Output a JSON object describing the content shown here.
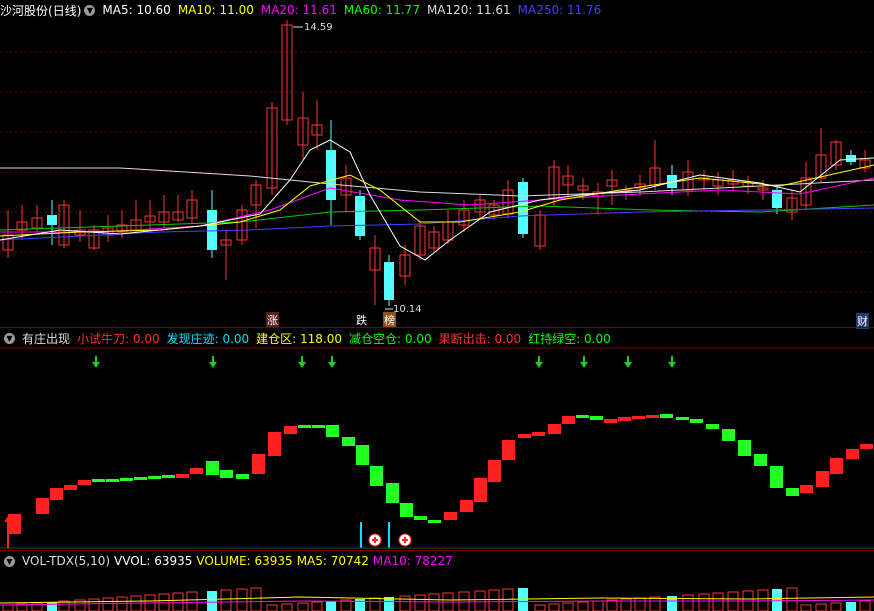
{
  "main": {
    "stock_name": "沙河股份",
    "period": "(日线)",
    "ma": [
      {
        "label": "MA5: 10.60",
        "color": "#ffffff"
      },
      {
        "label": "MA10: 11.00",
        "color": "#ffff00"
      },
      {
        "label": "MA20: 11.61",
        "color": "#ff00ff"
      },
      {
        "label": "MA60: 11.77",
        "color": "#00ff00"
      },
      {
        "label": "MA120: 11.61",
        "color": "#dddddd"
      },
      {
        "label": "MA250: 11.76",
        "color": "#4040ff"
      }
    ],
    "high_label": "14.59",
    "low_label": "10.14",
    "markers": [
      "涨",
      "跌",
      "榜",
      "财"
    ]
  },
  "indicator": {
    "name": "有庄出现",
    "items": [
      {
        "label": "小试牛刀: 0.00",
        "color": "#ff3030"
      },
      {
        "label": "发现庄迹: 0.00",
        "color": "#00e0ff"
      },
      {
        "label": "建仓区: 118.00",
        "color": "#ffff00"
      },
      {
        "label": "减仓空仓: 0.00",
        "color": "#00ff00"
      },
      {
        "label": "果断出击: 0.00",
        "color": "#ff3030"
      },
      {
        "label": "红持绿空: 0.00",
        "color": "#00ff00"
      }
    ],
    "colors": {
      "up": "#ff2020",
      "down": "#22ff22",
      "arrow": "#22cc22",
      "spike": "#00e0ff"
    }
  },
  "volume": {
    "name": "VOL-TDX(5,10)",
    "items": [
      {
        "label": "VVOL: 63935",
        "color": "#ffffff"
      },
      {
        "label": "VOLUME: 63935",
        "color": "#ffff00"
      },
      {
        "label": "MA5: 70742",
        "color": "#ffff00"
      },
      {
        "label": "MA10: 78227",
        "color": "#ff00ff"
      }
    ]
  },
  "colors": {
    "up": "#ff3232",
    "down": "#54fcfc",
    "grid": "#6a0000"
  }
}
